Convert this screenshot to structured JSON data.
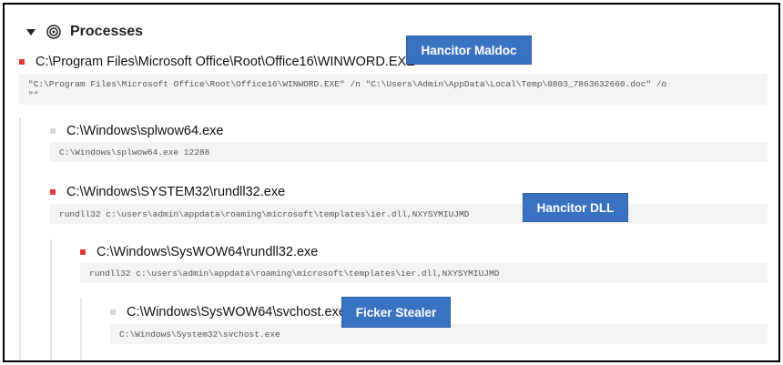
{
  "header": {
    "title": "Processes",
    "caret_icon": "caret-down-icon",
    "section_icon": "target-icon"
  },
  "processes": [
    {
      "path": "C:\\Program Files\\Microsoft Office\\Root\\Office16\\WINWORD.EXE",
      "cmdline": "\"C:\\Program Files\\Microsoft Office\\Root\\Office16\\WINWORD.EXE\" /n \"C:\\Users\\Admin\\AppData\\Local\\Temp\\0803_7863632660.doc\" /o\n\"\"",
      "bullet_color": "#e53935"
    },
    {
      "path": "C:\\Windows\\splwow64.exe",
      "cmdline": "C:\\Windows\\splwow64.exe 12288",
      "bullet_color": "#d8d8d8"
    },
    {
      "path": "C:\\Windows\\SYSTEM32\\rundll32.exe",
      "cmdline": "rundll32 c:\\users\\admin\\appdata\\roaming\\microsoft\\templates\\ier.dll,NXYSYMIUJMD",
      "bullet_color": "#e53935"
    },
    {
      "path": "C:\\Windows\\SysWOW64\\rundll32.exe",
      "cmdline": "rundll32 c:\\users\\admin\\appdata\\roaming\\microsoft\\templates\\ier.dll,NXYSYMIUJMD",
      "bullet_color": "#e53935"
    },
    {
      "path": "C:\\Windows\\SysWOW64\\svchost.exe",
      "cmdline": "C:\\Windows\\System32\\svchost.exe",
      "bullet_color": "#d8d8d8"
    }
  ],
  "annotations": {
    "maldoc": "Hancitor Maldoc",
    "dll": "Hancitor DLL",
    "stealer": "Ficker Stealer"
  },
  "colors": {
    "annotation_bg": "#3a72c2",
    "malicious": "#e53935",
    "benign": "#d8d8d8"
  }
}
